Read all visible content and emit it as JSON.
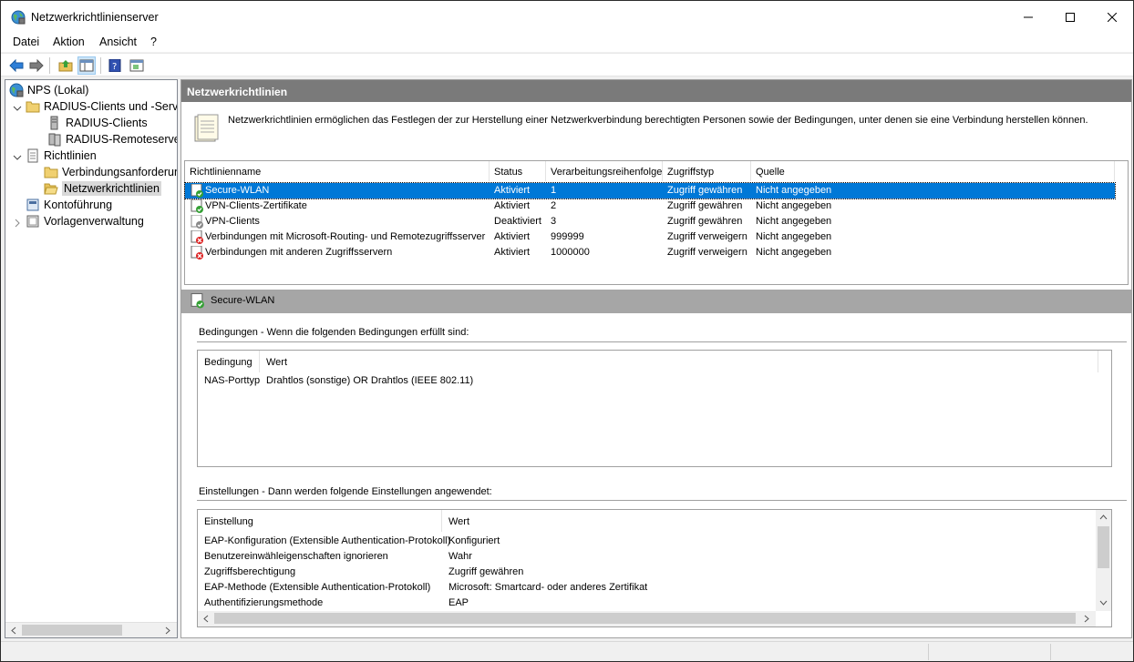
{
  "window": {
    "title": "Netzwerkrichtlinienserver"
  },
  "menu": [
    "Datei",
    "Aktion",
    "Ansicht",
    "?"
  ],
  "tree": {
    "items": [
      {
        "label": "NPS (Lokal)"
      },
      {
        "label": "RADIUS-Clients und -Server"
      },
      {
        "label": "RADIUS-Clients"
      },
      {
        "label": "RADIUS-Remoteservergruppen"
      },
      {
        "label": "Richtlinien"
      },
      {
        "label": "Verbindungsanforderungsrichtlinien"
      },
      {
        "label": "Netzwerkrichtlinien"
      },
      {
        "label": "Kontoführung"
      },
      {
        "label": "Vorlagenverwaltung"
      }
    ]
  },
  "pane": {
    "header": "Netzwerkrichtlinien",
    "description": "Netzwerkrichtlinien ermöglichen das Festlegen der zur Herstellung einer Netzwerkverbindung berechtigten Personen sowie der Bedingungen, unter denen sie eine Verbindung herstellen können."
  },
  "policies": {
    "columns": [
      "Richtlinienname",
      "Status",
      "Verarbeitungsreihenfolge",
      "Zugriffstyp",
      "Quelle"
    ],
    "rows": [
      {
        "name": "Secure-WLAN",
        "status": "Aktiviert",
        "order": "1",
        "access": "Zugriff gewähren",
        "source": "Nicht angegeben",
        "icon": "policy-grant-icon"
      },
      {
        "name": "VPN-Clients-Zertifikate",
        "status": "Aktiviert",
        "order": "2",
        "access": "Zugriff gewähren",
        "source": "Nicht angegeben",
        "icon": "policy-grant-icon"
      },
      {
        "name": "VPN-Clients",
        "status": "Deaktiviert",
        "order": "3",
        "access": "Zugriff gewähren",
        "source": "Nicht angegeben",
        "icon": "policy-disabled-icon"
      },
      {
        "name": "Verbindungen mit Microsoft-Routing- und Remotezugriffsserver",
        "status": "Aktiviert",
        "order": "999999",
        "access": "Zugriff verweigern",
        "source": "Nicht angegeben",
        "icon": "policy-deny-icon"
      },
      {
        "name": "Verbindungen mit anderen Zugriffsservern",
        "status": "Aktiviert",
        "order": "1000000",
        "access": "Zugriff verweigern",
        "source": "Nicht angegeben",
        "icon": "policy-deny-icon"
      }
    ]
  },
  "detail": {
    "title": "Secure-WLAN",
    "conditions": {
      "group_title": "Bedingungen - Wenn die folgenden Bedingungen erfüllt sind:",
      "columns": [
        "Bedingung",
        "Wert"
      ],
      "rows": [
        {
          "key": "NAS-Porttyp",
          "value": "Drahtlos (sonstige) OR Drahtlos (IEEE 802.11)"
        }
      ]
    },
    "settings": {
      "group_title": "Einstellungen - Dann werden folgende Einstellungen angewendet:",
      "columns": [
        "Einstellung",
        "Wert"
      ],
      "rows": [
        {
          "key": "EAP-Konfiguration (Extensible Authentication-Protokoll)",
          "value": "Konfiguriert"
        },
        {
          "key": "Benutzereinwähleigenschaften ignorieren",
          "value": "Wahr"
        },
        {
          "key": "Zugriffsberechtigung",
          "value": "Zugriff gewähren"
        },
        {
          "key": "EAP-Methode (Extensible Authentication-Protokoll)",
          "value": "Microsoft: Smartcard- oder anderes Zertifikat"
        },
        {
          "key": "Authentifizierungsmethode",
          "value": "EAP"
        }
      ]
    }
  },
  "colors": {
    "selection": "#0078d7",
    "pane_header": "#7a7a7a",
    "detail_header": "#a6a6a6"
  }
}
